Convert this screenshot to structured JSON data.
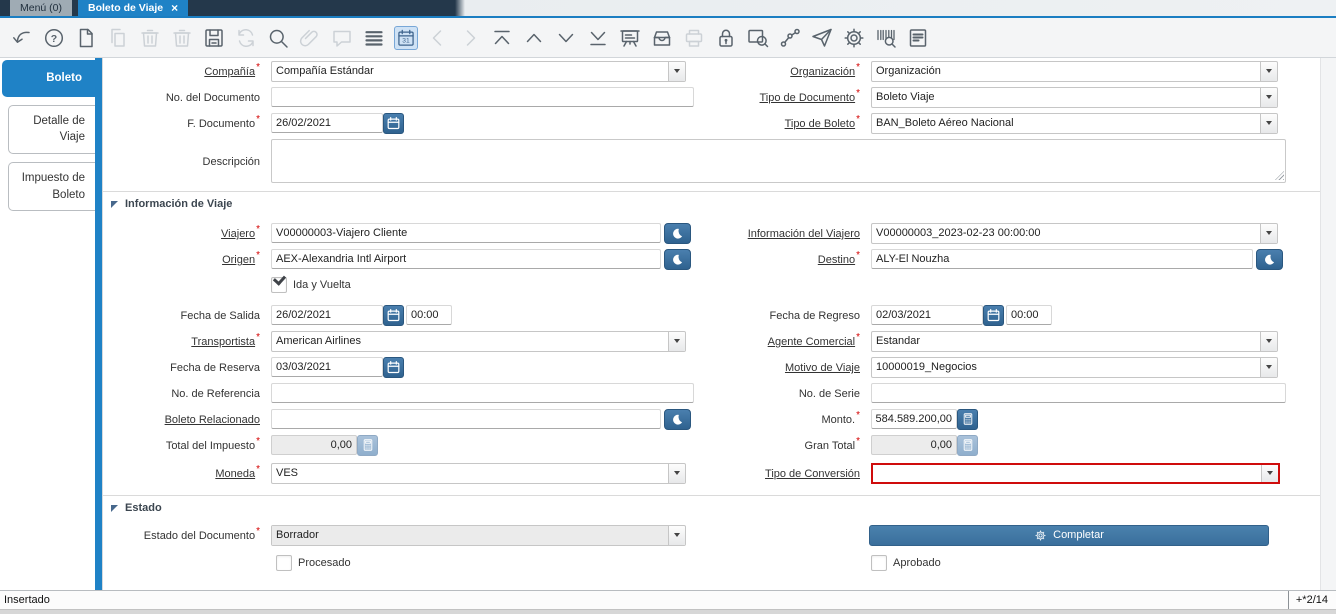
{
  "marks": {
    "required": "*",
    "close": "×"
  },
  "colors": {
    "accent_blue": "#1f82c6",
    "button_blue": "#31689b",
    "error_red": "#cf0c0c",
    "tabbar_dark": "#24384b"
  },
  "tabs": {
    "menu": "Menú (0)",
    "active": "Boleto de Viaje"
  },
  "toolbar": {
    "items": [
      {
        "icon": "undo"
      },
      {
        "icon": "help"
      },
      {
        "icon": "new-record"
      },
      {
        "icon": "copy-record",
        "disabled": true
      },
      {
        "icon": "delete-record",
        "disabled": true
      },
      {
        "icon": "delete-selection",
        "disabled": true
      },
      {
        "icon": "save"
      },
      {
        "icon": "requery",
        "disabled": true
      },
      {
        "icon": "find"
      },
      {
        "icon": "attachment",
        "disabled": true
      },
      {
        "icon": "chat",
        "disabled": true
      },
      {
        "icon": "grid-toggle"
      },
      {
        "icon": "calendar",
        "active": true
      },
      {
        "icon": "nav-prev",
        "disabled": true
      },
      {
        "icon": "nav-next",
        "disabled": true
      },
      {
        "icon": "first-record"
      },
      {
        "icon": "parent-record"
      },
      {
        "icon": "detail-record"
      },
      {
        "icon": "last-record"
      },
      {
        "icon": "report"
      },
      {
        "icon": "archive"
      },
      {
        "icon": "print",
        "disabled": true
      },
      {
        "icon": "lock"
      },
      {
        "icon": "zoom-across"
      },
      {
        "icon": "workflow"
      },
      {
        "icon": "send-mail"
      },
      {
        "icon": "preference"
      },
      {
        "icon": "barcode-scan"
      },
      {
        "icon": "postit"
      }
    ]
  },
  "sidebar": {
    "tabs": [
      {
        "label": "Boleto",
        "active": true
      },
      {
        "label": "Detalle de Viaje",
        "active": false
      },
      {
        "label": "Impuesto de Boleto",
        "active": false
      }
    ]
  },
  "sections": {
    "viaje": "Información de Viaje",
    "estado": "Estado"
  },
  "form": {
    "compania": {
      "label": "Compañía",
      "value": "Compañía Estándar"
    },
    "organizacion": {
      "label": "Organización",
      "value": "Organización"
    },
    "no_documento": {
      "label": "No. del Documento",
      "value": ""
    },
    "tipo_documento": {
      "label": "Tipo de Documento",
      "value": "Boleto Viaje"
    },
    "f_documento": {
      "label": "F. Documento",
      "value": "26/02/2021"
    },
    "tipo_boleto": {
      "label": "Tipo de Boleto",
      "value": "BAN_Boleto Aéreo Nacional"
    },
    "descripcion": {
      "label": "Descripción",
      "value": ""
    },
    "viajero": {
      "label": "Viajero",
      "value": "V00000003-Viajero Cliente"
    },
    "info_viajero": {
      "label": "Información del Viajero",
      "value": "V00000003_2023-02-23 00:00:00"
    },
    "origen": {
      "label": "Origen",
      "value": "AEX-Alexandria Intl Airport"
    },
    "destino": {
      "label": "Destino",
      "value": "ALY-El Nouzha"
    },
    "ida_vuelta": {
      "label": "Ida y Vuelta",
      "checked": true
    },
    "fecha_salida": {
      "label": "Fecha de Salida",
      "date": "26/02/2021",
      "time": "00:00"
    },
    "fecha_regreso": {
      "label": "Fecha de Regreso",
      "date": "02/03/2021",
      "time": "00:00"
    },
    "transportista": {
      "label": "Transportista",
      "value": "American Airlines"
    },
    "agente": {
      "label": "Agente Comercial",
      "value": "Estandar"
    },
    "fecha_reserva": {
      "label": "Fecha de Reserva",
      "date": "03/03/2021"
    },
    "motivo": {
      "label": "Motivo de Viaje",
      "value": "10000019_Negocios"
    },
    "no_referencia": {
      "label": "No. de Referencia",
      "value": ""
    },
    "no_serie": {
      "label": "No. de Serie",
      "value": ""
    },
    "boleto_rel": {
      "label": "Boleto Relacionado",
      "value": ""
    },
    "monto": {
      "label": "Monto.",
      "value": "584.589.200,00"
    },
    "total_impuesto": {
      "label": "Total del Impuesto",
      "value": "0,00"
    },
    "gran_total": {
      "label": "Gran Total",
      "value": "0,00"
    },
    "moneda": {
      "label": "Moneda",
      "value": "VES"
    },
    "tipo_conversion": {
      "label": "Tipo de Conversión",
      "value": ""
    },
    "estado_doc": {
      "label": "Estado del Documento",
      "value": "Borrador"
    },
    "procesado": {
      "label": "Procesado",
      "checked": false
    },
    "completar": {
      "label": "Completar"
    },
    "aprobado": {
      "label": "Aprobado",
      "checked": false
    }
  },
  "statusbar": {
    "left": "Insertado",
    "right": "+*2/14"
  }
}
